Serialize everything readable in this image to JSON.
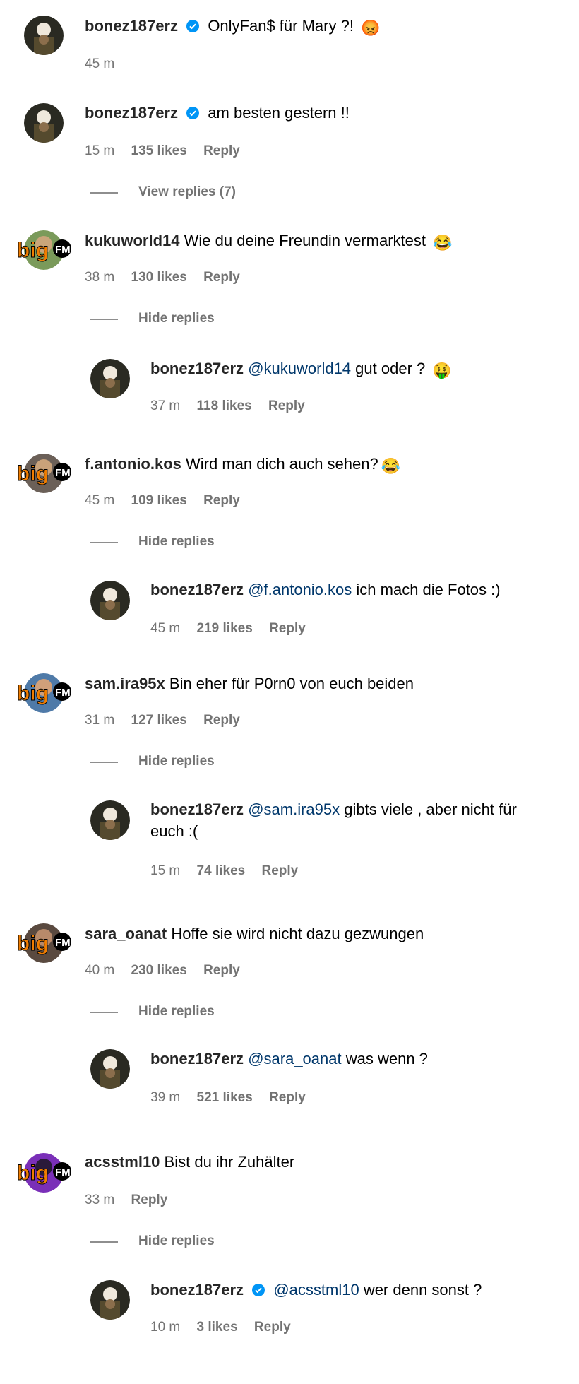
{
  "comments": [
    {
      "id": "c1",
      "user": "bonez187erz",
      "verified": true,
      "text": "OnlyFan$ für Mary ?!",
      "emoji": "😡",
      "time": "45 m",
      "likes": "",
      "reply": ""
    },
    {
      "id": "c2",
      "user": "bonez187erz",
      "verified": true,
      "text": "am besten gestern !!",
      "time": "15 m",
      "likes": "135 likes",
      "reply": "Reply",
      "toggle": "View replies (7)"
    },
    {
      "id": "c3",
      "user": "kukuworld14",
      "verified": false,
      "text": "Wie du deine Freundin vermarktest",
      "emoji": "😂",
      "time": "38 m",
      "likes": "130 likes",
      "reply": "Reply",
      "toggle": "Hide replies",
      "replies": [
        {
          "user": "bonez187erz",
          "mention": "@kukuworld14",
          "text": "gut oder ?",
          "emoji": "🤑",
          "time": "37 m",
          "likes": "118 likes",
          "reply": "Reply"
        }
      ]
    },
    {
      "id": "c4",
      "user": "f.antonio.kos",
      "verified": false,
      "text": "Wird man dich auch sehen?",
      "emoji": "😂",
      "time": "45 m",
      "likes": "109 likes",
      "reply": "Reply",
      "toggle": "Hide replies",
      "replies": [
        {
          "user": "bonez187erz",
          "mention": "@f.antonio.kos",
          "text": "ich mach die Fotos :)",
          "time": "45 m",
          "likes": "219 likes",
          "reply": "Reply"
        }
      ]
    },
    {
      "id": "c5",
      "user": "sam.ira95x",
      "verified": false,
      "text": "Bin eher für P0rn0 von euch beiden",
      "time": "31 m",
      "likes": "127 likes",
      "reply": "Reply",
      "toggle": "Hide replies",
      "replies": [
        {
          "user": "bonez187erz",
          "mention": "@sam.ira95x",
          "text": "gibts viele , aber nicht für",
          "text2": "euch :(",
          "time": "15 m",
          "likes": "74 likes",
          "reply": "Reply"
        }
      ]
    },
    {
      "id": "c6",
      "user": "sara_oanat",
      "verified": false,
      "text": "Hoffe sie wird nicht dazu gezwungen",
      "time": "40 m",
      "likes": "230 likes",
      "reply": "Reply",
      "toggle": "Hide replies",
      "replies": [
        {
          "user": "bonez187erz",
          "mention": "@sara_oanat",
          "text": "was wenn ?",
          "time": "39 m",
          "likes": "521 likes",
          "reply": "Reply"
        }
      ]
    },
    {
      "id": "c7",
      "user": "acsstml10",
      "verified": false,
      "text": "Bist du ihr Zuhälter",
      "time": "33 m",
      "likes": "",
      "reply": "Reply",
      "toggle": "Hide replies",
      "replies": [
        {
          "user": "bonez187erz",
          "verified": true,
          "mention": "@acsstml10",
          "text": "wer denn sonst ?",
          "time": "10 m",
          "likes": "3 likes",
          "reply": "Reply"
        }
      ]
    }
  ],
  "badge": {
    "logo_text": "big",
    "logo_sub": "FM"
  },
  "colors": {
    "username": "#262626",
    "meta": "#737373",
    "mention": "#00376b",
    "verified": "#0095f6",
    "logo_orange": "#f07d00"
  }
}
